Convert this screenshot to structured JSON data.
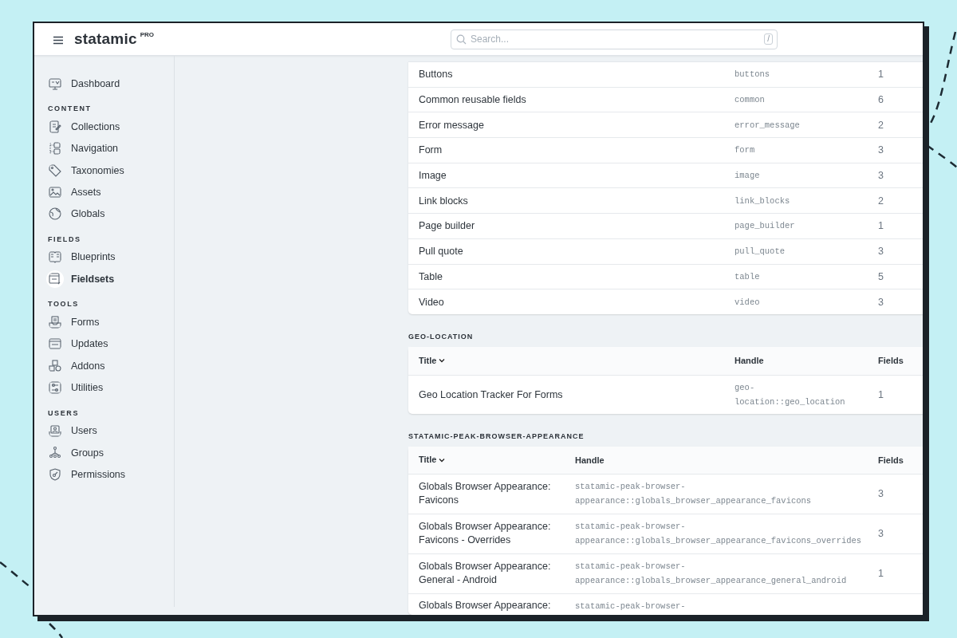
{
  "header": {
    "brand": "statamic",
    "badge": "PRO",
    "search": {
      "placeholder": "Search...",
      "shortcut": "/"
    }
  },
  "sidebar": {
    "sections": [
      {
        "items": [
          {
            "label": "Dashboard",
            "selected": false
          }
        ]
      },
      {
        "heading": "CONTENT",
        "items": [
          {
            "label": "Collections",
            "selected": false
          },
          {
            "label": "Navigation",
            "selected": false
          },
          {
            "label": "Taxonomies",
            "selected": false
          },
          {
            "label": "Assets",
            "selected": false
          },
          {
            "label": "Globals",
            "selected": false
          }
        ]
      },
      {
        "heading": "FIELDS",
        "items": [
          {
            "label": "Blueprints",
            "selected": false
          },
          {
            "label": "Fieldsets",
            "selected": true
          }
        ]
      },
      {
        "heading": "TOOLS",
        "items": [
          {
            "label": "Forms",
            "selected": false
          },
          {
            "label": "Updates",
            "selected": false
          },
          {
            "label": "Addons",
            "selected": false
          },
          {
            "label": "Utilities",
            "selected": false
          }
        ]
      },
      {
        "heading": "USERS",
        "items": [
          {
            "label": "Users",
            "selected": false
          },
          {
            "label": "Groups",
            "selected": false
          },
          {
            "label": "Permissions",
            "selected": false
          }
        ]
      }
    ]
  },
  "groups": [
    {
      "rows": [
        {
          "title": "Buttons",
          "handle": "buttons",
          "fields": "1"
        },
        {
          "title": "Common reusable fields",
          "handle": "common",
          "fields": "6"
        },
        {
          "title": "Error message",
          "handle": "error_message",
          "fields": "2"
        },
        {
          "title": "Form",
          "handle": "form",
          "fields": "3"
        },
        {
          "title": "Image",
          "handle": "image",
          "fields": "3"
        },
        {
          "title": "Link blocks",
          "handle": "link_blocks",
          "fields": "2"
        },
        {
          "title": "Page builder",
          "handle": "page_builder",
          "fields": "1"
        },
        {
          "title": "Pull quote",
          "handle": "pull_quote",
          "fields": "3"
        },
        {
          "title": "Table",
          "handle": "table",
          "fields": "5"
        },
        {
          "title": "Video",
          "handle": "video",
          "fields": "3"
        }
      ]
    },
    {
      "heading": "GEO-LOCATION",
      "columns": [
        {
          "label": "Title",
          "sorted": true
        },
        {
          "label": "Handle",
          "sorted": false
        },
        {
          "label": "Fields",
          "sorted": false
        }
      ],
      "rows": [
        {
          "title": "Geo Location Tracker For Forms",
          "handle": "geo-location::geo_location",
          "fields": "1"
        }
      ]
    },
    {
      "heading": "STATAMIC-PEAK-BROWSER-APPEARANCE",
      "columns": [
        {
          "label": "Title",
          "sorted": true
        },
        {
          "label": "Handle",
          "sorted": false
        },
        {
          "label": "Fields",
          "sorted": false
        }
      ],
      "rows": [
        {
          "title": "Globals Browser Appearance: Favicons",
          "handle": "statamic-peak-browser-appearance::globals_browser_appearance_favicons",
          "fields": "3"
        },
        {
          "title": "Globals Browser Appearance: Favicons - Overrides",
          "handle": "statamic-peak-browser-appearance::globals_browser_appearance_favicons_overrides",
          "fields": "3"
        },
        {
          "title": "Globals Browser Appearance: General - Android",
          "handle": "statamic-peak-browser-appearance::globals_browser_appearance_general_android",
          "fields": "1"
        },
        {
          "title": "Globals Browser Appearance:",
          "handle": "statamic-peak-browser-"
        }
      ]
    }
  ]
}
